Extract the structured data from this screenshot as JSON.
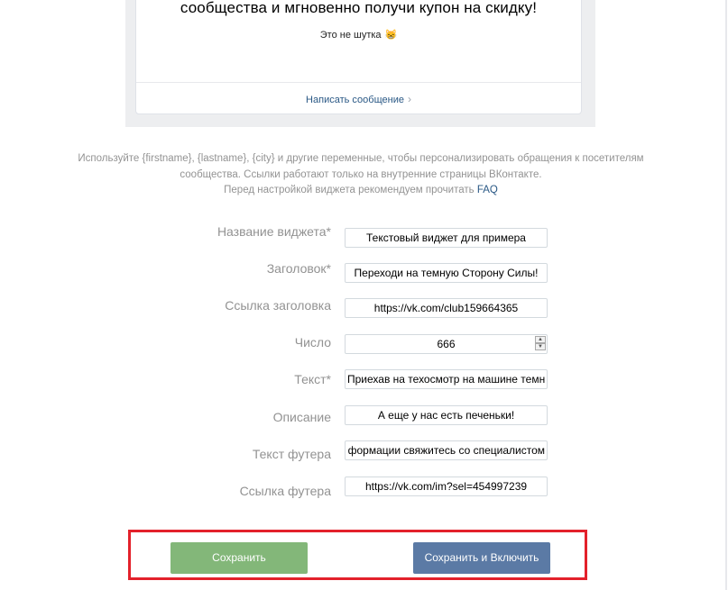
{
  "preview": {
    "title": "сообщества и мгновенно получи купон на скидку!",
    "subtitle": "Это не шутка",
    "emoji": "😸",
    "link": "Написать сообщение",
    "link_chevron": "›"
  },
  "info": {
    "line1": "Используйте {firstname}, {lastname}, {city} и другие переменные, чтобы персонализировать обращения к посетителям",
    "line2": "сообщества. Ссылки работают только на внутренние страницы ВКонтакте.",
    "line3": "Перед настройкой виджета рекомендуем прочитать",
    "faq": "FAQ"
  },
  "form": {
    "widget_name": {
      "label": "Название виджета*",
      "value": "Текстовый виджет для примера"
    },
    "heading": {
      "label": "Заголовок*",
      "value": "Переходи на темную Сторону Силы!"
    },
    "heading_link": {
      "label": "Ссылка заголовка",
      "value": "https://vk.com/club159664365"
    },
    "number": {
      "label": "Число",
      "value": "666"
    },
    "text": {
      "label": "Текст*",
      "value": "Приехав на техосмотр на машине темн"
    },
    "description": {
      "label": "Описание",
      "value": "А еще у нас есть печеньки!"
    },
    "footer_text": {
      "label": "Текст футера",
      "value": "формации свяжитесь со специалистом"
    },
    "footer_link": {
      "label": "Ссылка футера",
      "value": "https://vk.com/im?sel=454997239"
    }
  },
  "buttons": {
    "save": "Сохранить",
    "save_enable": "Сохранить и Включить"
  },
  "colors": {
    "link": "#2a5885",
    "save_button": "#83b779",
    "save_enable_button": "#5b7aa5",
    "highlight": "#e3212b"
  }
}
